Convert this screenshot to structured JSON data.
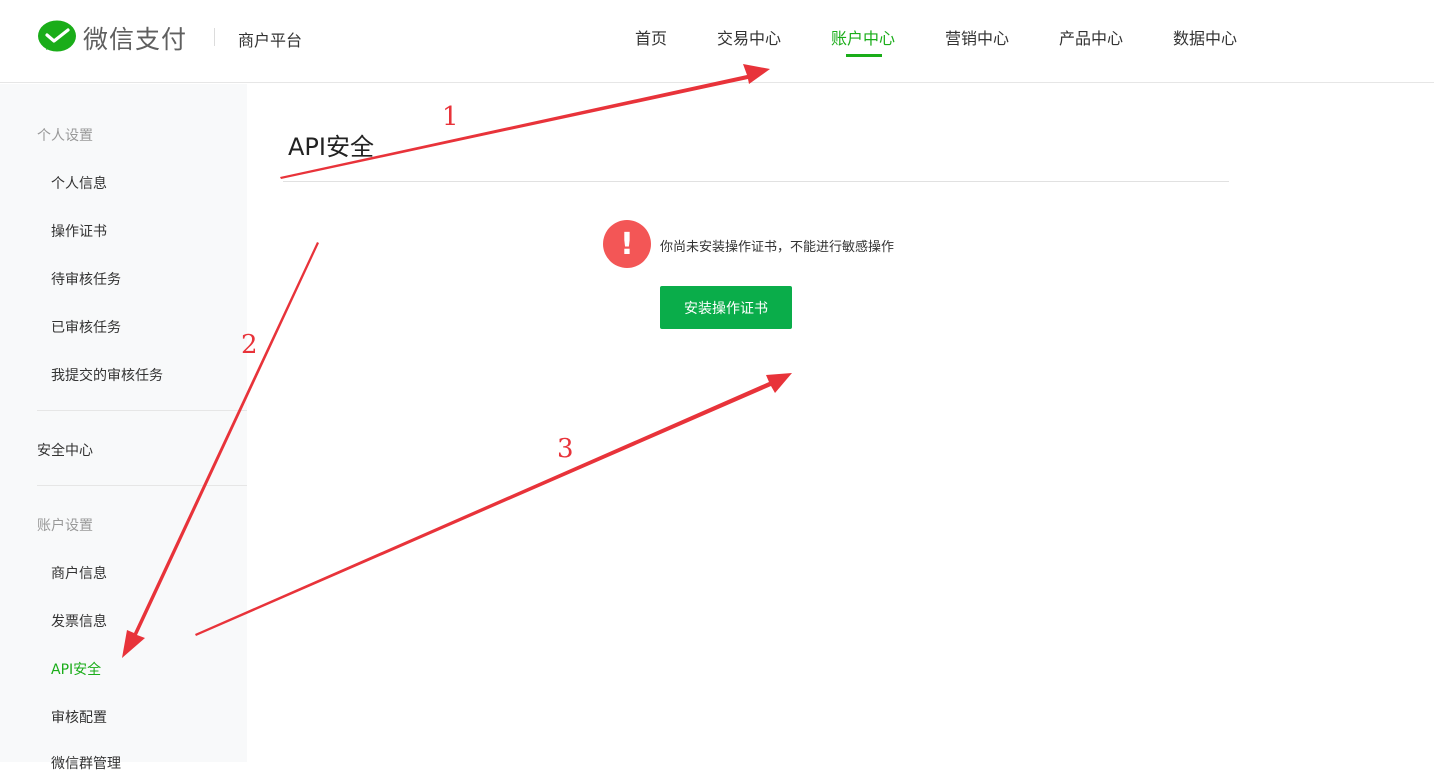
{
  "header": {
    "logo_text": "微信支付",
    "platform": "商户平台",
    "nav": [
      {
        "label": "首页"
      },
      {
        "label": "交易中心"
      },
      {
        "label": "账户中心",
        "active": true
      },
      {
        "label": "营销中心"
      },
      {
        "label": "产品中心"
      },
      {
        "label": "数据中心"
      }
    ]
  },
  "sidebar": {
    "personal_group": "个人设置",
    "personal_items": [
      "个人信息",
      "操作证书",
      "待审核任务",
      "已审核任务",
      "我提交的审核任务"
    ],
    "security_center": "安全中心",
    "account_group": "账户设置",
    "account_items": [
      "商户信息",
      "发票信息",
      "API安全",
      "审核配置",
      "微信群管理"
    ],
    "active_item": "API安全"
  },
  "main": {
    "title": "API安全",
    "warning_text": "你尚未安装操作证书，不能进行敏感操作",
    "install_button": "安装操作证书"
  },
  "annotations": {
    "labels": [
      "1",
      "2",
      "3"
    ],
    "color": "#e8333a"
  },
  "colors": {
    "accent": "#1aad19",
    "button": "#0aad4a",
    "warning": "#f35656"
  },
  "icons": {
    "logo": "wechat-pay-logo-icon",
    "warning": "exclamation-icon"
  }
}
